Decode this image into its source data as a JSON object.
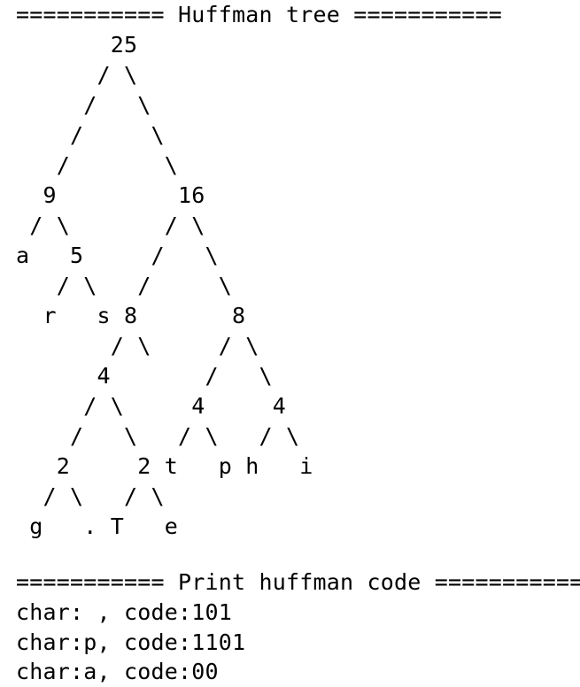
{
  "console": {
    "lines": [
      "=========== Huffman tree ===========",
      "       25",
      "      / \\",
      "     /   \\",
      "    /     \\",
      "   /       \\",
      "  9         16",
      " / \\       / \\",
      "a   5     /   \\",
      "   / \\   /     \\",
      "  r   s 8       8",
      "       / \\     / \\",
      "      4       /   \\",
      "     / \\     4     4",
      "    /   \\   / \\   / \\",
      "   2     2 t   p h   i",
      "  / \\   / \\",
      " g   . T   e",
      "",
      "=========== Print huffman code ===========",
      "char: , code:101",
      "char:p, code:1101",
      "char:a, code:00"
    ]
  }
}
